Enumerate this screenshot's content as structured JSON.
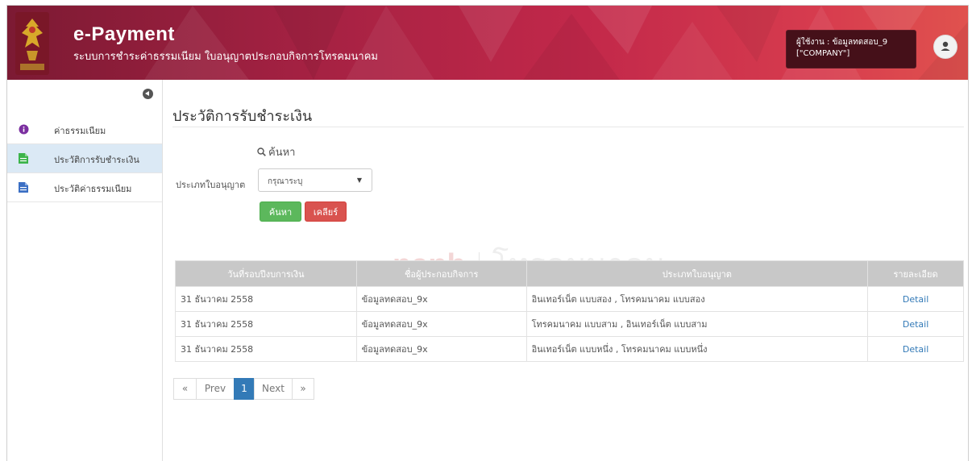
{
  "header": {
    "app_title": "e-Payment",
    "app_subtitle": "ระบบการชำระค่าธรรมเนียม ใบอนุญาตประกอบกิจการโทรคมนาคม",
    "user_line1": "ผู้ใช้งาน : ข้อมูลทดสอบ_9",
    "user_line2": "[\"COMPANY\"]",
    "colors": {
      "header_start": "#7c1a33",
      "header_end": "#e0524e",
      "user_box": "#451019"
    }
  },
  "sidebar": {
    "items": [
      {
        "label": "ค่าธรรมเนียม",
        "icon": "info-circle-icon",
        "icon_color": "#7b2fa0"
      },
      {
        "label": "ประวัติการรับชำระเงิน",
        "icon": "document-icon",
        "icon_color": "#3cb44a",
        "active": true
      },
      {
        "label": "ประวัติค่าธรรมเนียม",
        "icon": "document-icon",
        "icon_color": "#3b6fc4"
      }
    ]
  },
  "main": {
    "page_title": "ประวัติการรับชำระเงิน",
    "search": {
      "heading": "ค้นหา",
      "filter_label": "ประเภทใบอนุญาต",
      "select_value": "กรุณาระบุ",
      "search_button": "ค้นหา",
      "clear_button": "เคลียร์"
    },
    "watermark": {
      "left": "nanb",
      "right": "โทรคมนาคม"
    },
    "table": {
      "headers": [
        "วันที่รอบปีงบการเงิน",
        "ชื่อผู้ประกอบกิจการ",
        "ประเภทใบอนุญาต",
        "รายละเอียด"
      ],
      "rows": [
        {
          "date": "31 ธันวาคม 2558",
          "operator": "ข้อมูลทดสอบ_9x",
          "license_type": "อินเทอร์เน็ต แบบสอง , โทรคมนาคม แบบสอง",
          "detail": "Detail"
        },
        {
          "date": "31 ธันวาคม 2558",
          "operator": "ข้อมูลทดสอบ_9x",
          "license_type": "โทรคมนาคม แบบสาม , อินเทอร์เน็ต แบบสาม",
          "detail": "Detail"
        },
        {
          "date": "31 ธันวาคม 2558",
          "operator": "ข้อมูลทดสอบ_9x",
          "license_type": "อินเทอร์เน็ต แบบหนึ่ง , โทรคมนาคม แบบหนึ่ง",
          "detail": "Detail"
        }
      ]
    },
    "pagination": {
      "first": "«",
      "prev": "Prev",
      "current": "1",
      "next": "Next",
      "last": "»"
    }
  }
}
